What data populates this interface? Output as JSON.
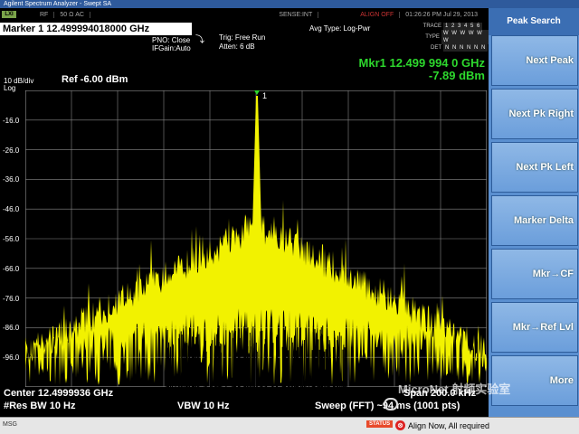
{
  "window": {
    "title": "Agilent Spectrum Analyzer - Swept SA"
  },
  "infobar": {
    "lxi": "LXI",
    "rf": "RF",
    "impedance": "50 Ω  AC",
    "sense": "SENSE:INT",
    "align": "ALIGN OFF",
    "datetime": "01:26:26 PM Jul 29, 2013"
  },
  "header": {
    "marker_title": "Marker 1  12.499994018000 GHz",
    "pno": "PNO: Close",
    "ifgain": "IFGain:Auto",
    "trig": "Trig: Free Run",
    "atten": "Atten: 6 dB",
    "avg_type": "Avg Type: Log-Pwr",
    "trace_label": "TRACE",
    "trace_value": "1 2 3 4 5 6",
    "type_label": "TYPE",
    "type_value": "W W W W W W",
    "det_label": "DET",
    "det_value": "N N N N N N"
  },
  "readout": {
    "marker_freq": "Mkr1 12.499 994 0 GHz",
    "marker_amp": "-7.89 dBm",
    "scale": "10 dB/div",
    "scale_type": "Log",
    "ref_level": "Ref -6.00 dBm"
  },
  "plot": {
    "marker_label": "1",
    "y_labels": [
      "-16.0",
      "-26.0",
      "-36.0",
      "-46.0",
      "-56.0",
      "-66.0",
      "-76.0",
      "-86.0",
      "-96.0"
    ]
  },
  "bottom": {
    "center": "Center 12.4999936 GHz",
    "res_bw": "#Res BW 10 Hz",
    "vbw": "VBW 10 Hz",
    "span": "Span 200.0 kHz",
    "sweep": "Sweep (FFT) ~94 ms (1001 pts)"
  },
  "statusbar": {
    "msg": "MSG",
    "status_label": "STATUS",
    "status_text": "Align Now, All required"
  },
  "softkeys": {
    "title": "Peak Search",
    "items": [
      {
        "label": "Next Peak"
      },
      {
        "label": "Next Pk Right"
      },
      {
        "label": "Next Pk Left"
      },
      {
        "label": "Marker Delta"
      },
      {
        "label": "Mkr→CF"
      },
      {
        "label": "Mkr→Ref Lvl"
      },
      {
        "label": "More"
      }
    ]
  },
  "watermark": {
    "text": "MicroNet 射频实验室"
  },
  "colors": {
    "trace": "#f2f200",
    "marker_readout": "#2dd82d",
    "softkey_panel": "#5a8fd0",
    "grid": "#888888"
  }
}
